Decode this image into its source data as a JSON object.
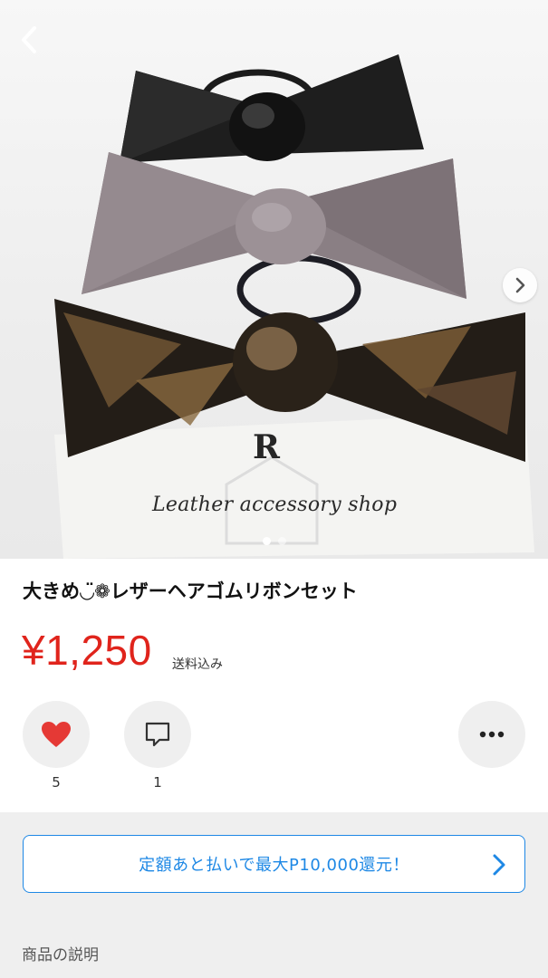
{
  "product": {
    "title": "大きめ◡̈❁レザーヘアゴムリボンセット",
    "price": "¥1,250",
    "shipping": "送料込み",
    "image": {
      "card_logo": "R",
      "card_text": "Leather accessory shop",
      "slide_index": 1,
      "slide_count": 2
    }
  },
  "actions": {
    "like_count": "5",
    "comment_count": "1"
  },
  "promo": {
    "text": "定額あと払いで最大P10,000還元！"
  },
  "sections": {
    "description_label": "商品の説明"
  },
  "colors": {
    "price": "#e0241c",
    "heart": "#e53935",
    "accent": "#1e88e5"
  },
  "icons": [
    "chevron-left-icon",
    "chevron-right-icon",
    "heart-icon",
    "comment-icon",
    "more-icon"
  ]
}
